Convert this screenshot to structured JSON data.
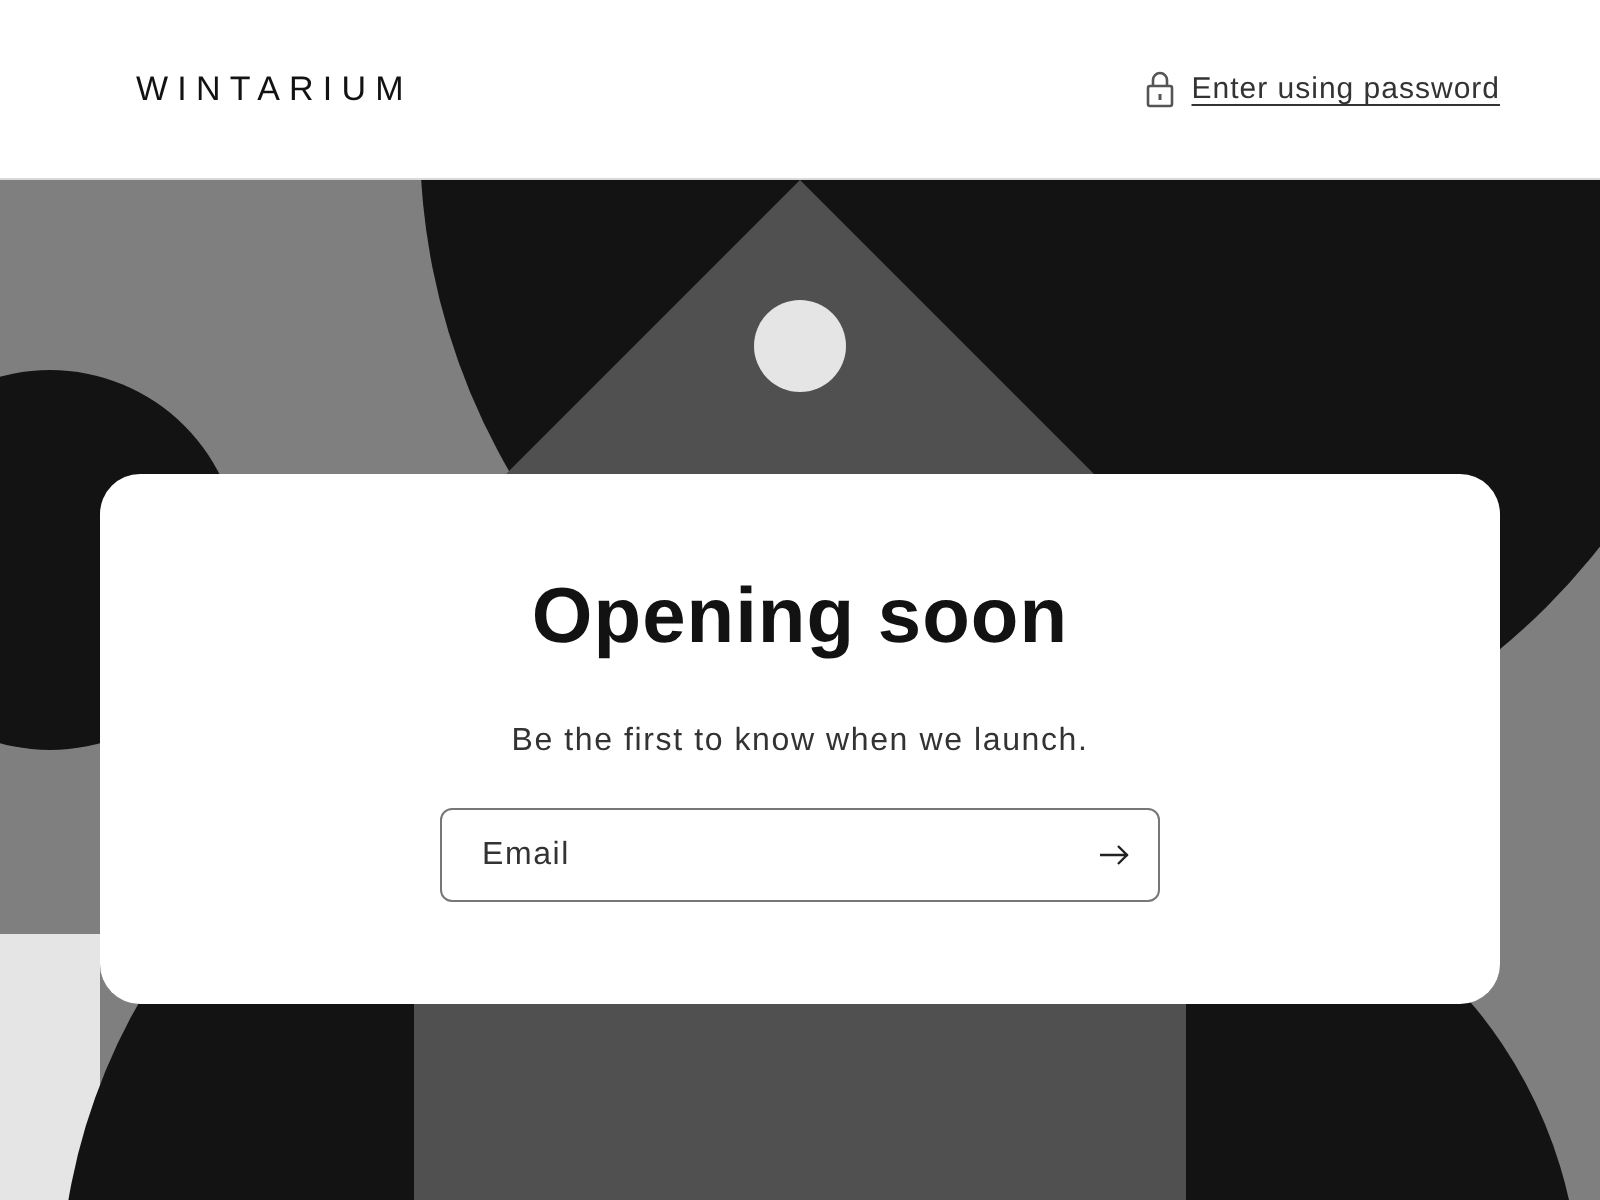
{
  "header": {
    "logo": "WINTARIUM",
    "password_link": "Enter using password"
  },
  "hero": {
    "title": "Opening soon",
    "subtitle": "Be the first to know when we launch.",
    "email_field": {
      "placeholder": "Email"
    }
  }
}
